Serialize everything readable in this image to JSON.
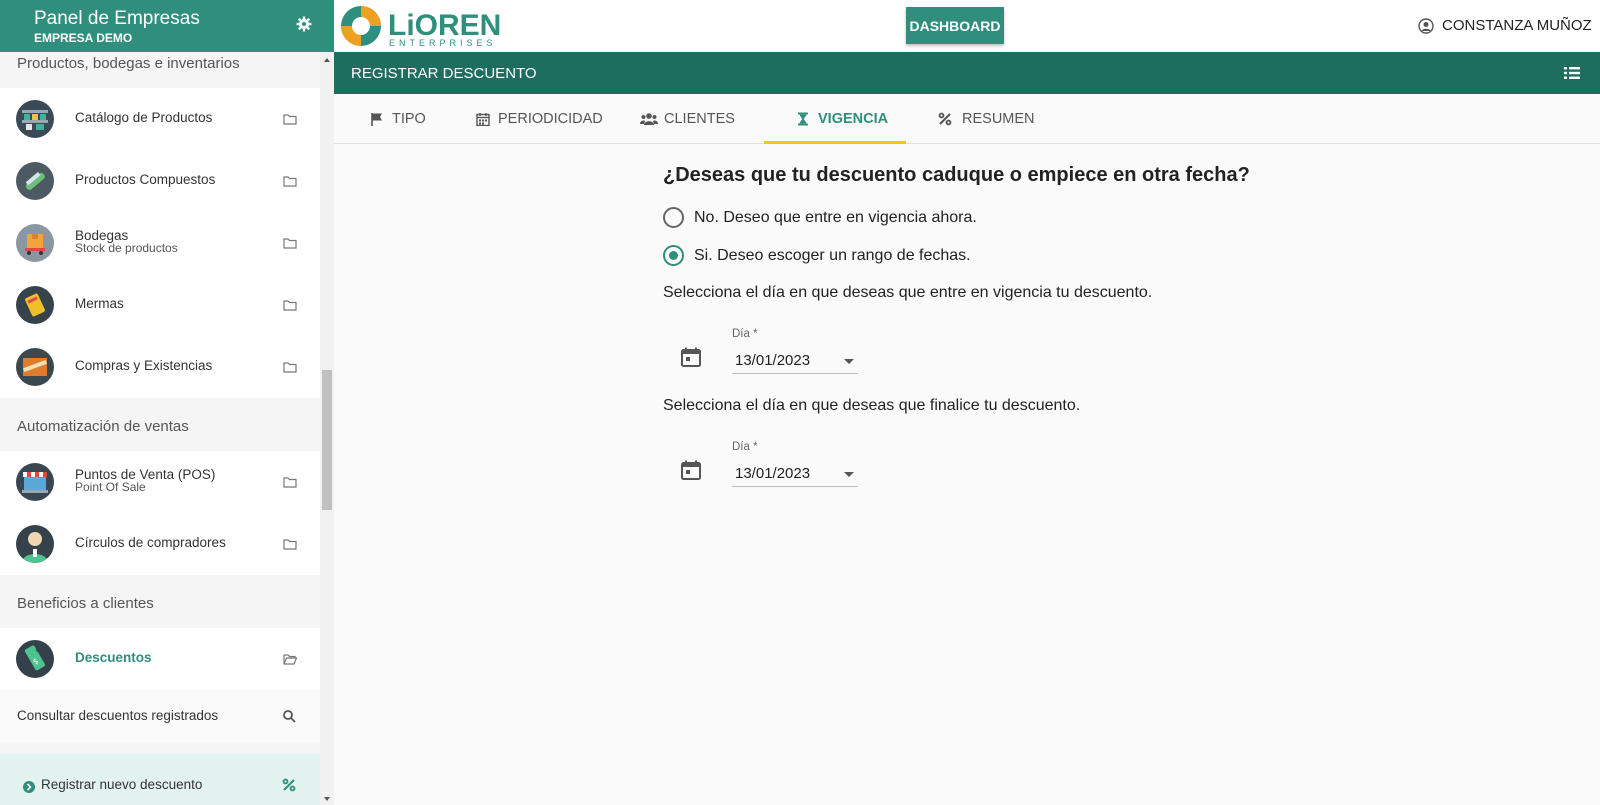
{
  "sidebar": {
    "title": "Panel de Empresas",
    "subtitle": "EMPRESA DEMO",
    "sections": {
      "products": "Productos, bodegas e inventarios",
      "sales": "Automatización de ventas",
      "benefits": "Beneficios a clientes"
    },
    "items": {
      "catalog": {
        "label": "Catálogo de Productos"
      },
      "composite": {
        "label": "Productos Compuestos"
      },
      "warehouses": {
        "label": "Bodegas",
        "sub": "Stock de productos"
      },
      "losses": {
        "label": "Mermas"
      },
      "purchases": {
        "label": "Compras y Existencias"
      },
      "pos": {
        "label": "Puntos de Venta (POS)",
        "sub": "Point Of Sale"
      },
      "circles": {
        "label": "Círculos de compradores"
      },
      "discounts": {
        "label": "Descuentos"
      }
    },
    "subitems": {
      "consult": "Consultar descuentos registrados",
      "register": "Registrar nuevo descuento"
    }
  },
  "topbar": {
    "logo_text": "LiOREN",
    "logo_sub": "ENTERPRISES",
    "dashboard_label": "DASHBOARD",
    "user_name": "CONSTANZA MUÑOZ"
  },
  "titlebar": {
    "title": "REGISTRAR DESCUENTO"
  },
  "tabs": [
    {
      "label": "TIPO",
      "icon": "flag-icon"
    },
    {
      "label": "PERIODICIDAD",
      "icon": "calendar-icon"
    },
    {
      "label": "CLIENTES",
      "icon": "users-icon"
    },
    {
      "label": "VIGENCIA",
      "icon": "hourglass-icon",
      "active": true
    },
    {
      "label": "RESUMEN",
      "icon": "percent-icon"
    }
  ],
  "content": {
    "question": "¿Deseas que tu descuento caduque o empiece en otra fecha?",
    "option_now": "No. Deseo que entre en vigencia ahora.",
    "option_range": "Si. Deseo escoger un rango de fechas.",
    "start_instruction": "Selecciona el día en que deseas que entre en vigencia tu descuento.",
    "end_instruction": "Selecciona el día en que deseas que finalice tu descuento.",
    "start_date": {
      "label": "Día *",
      "value": "13/01/2023"
    },
    "end_date": {
      "label": "Día *",
      "value": "13/01/2023"
    }
  },
  "colors": {
    "primary": "#2f8f7c",
    "dark": "#1d6e5e",
    "accent": "#f5c518"
  }
}
